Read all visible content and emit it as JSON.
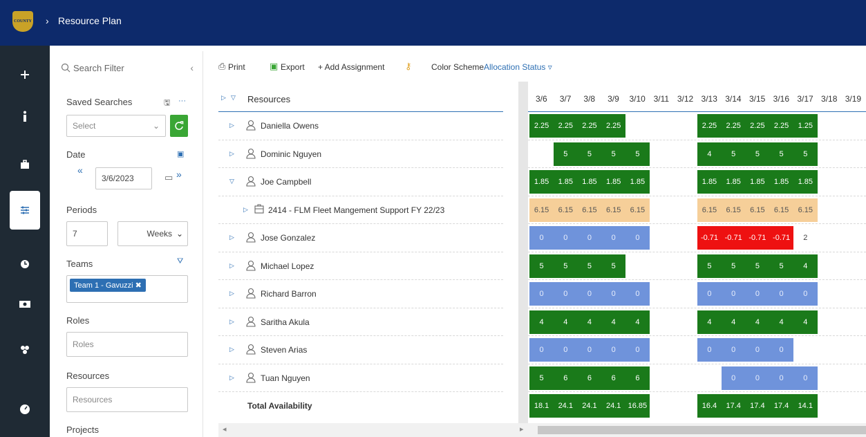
{
  "header": {
    "app_title": "Resource Plan",
    "logo_alt": "COUNTY"
  },
  "rail": {
    "items": [
      "plus-icon",
      "info-icon",
      "briefcase-icon",
      "sliders-icon",
      "clock-icon",
      "cash-icon",
      "people-icon",
      "dashboard-icon"
    ],
    "active_index": 3
  },
  "filter": {
    "search_placeholder": "Search Filter",
    "saved_searches_label": "Saved Searches",
    "saved_select_placeholder": "Select",
    "date_label": "Date",
    "date_value": "3/6/2023",
    "periods_label": "Periods",
    "periods_count": "7",
    "periods_unit": "Weeks",
    "teams_label": "Teams",
    "team_tag": "Team 1 - Gavuzzi",
    "roles_label": "Roles",
    "roles_placeholder": "Roles",
    "resources_label": "Resources",
    "resources_placeholder": "Resources",
    "projects_label": "Projects"
  },
  "toolbar": {
    "print": "Print",
    "export": "Export",
    "add_assignment": "+ Add Assignment",
    "color_scheme_label": "Color Scheme",
    "color_scheme_value": "Allocation Status"
  },
  "grid": {
    "resources_header": "Resources",
    "dates": [
      "3/6",
      "3/7",
      "3/8",
      "3/9",
      "3/10",
      "3/11",
      "3/12",
      "3/13",
      "3/14",
      "3/15",
      "3/16",
      "3/17",
      "3/18",
      "3/19"
    ],
    "rows": [
      {
        "name": "Daniella Owens",
        "type": "person",
        "expand": "collapsed"
      },
      {
        "name": "Dominic Nguyen",
        "type": "person",
        "expand": "collapsed"
      },
      {
        "name": "Joe Campbell",
        "type": "person",
        "expand": "expanded"
      },
      {
        "name": "2414 - FLM Fleet Mangement Support FY 22/23",
        "type": "project",
        "expand": "collapsed"
      },
      {
        "name": "Jose Gonzalez",
        "type": "person",
        "expand": "collapsed"
      },
      {
        "name": "Michael Lopez",
        "type": "person",
        "expand": "collapsed"
      },
      {
        "name": "Richard Barron",
        "type": "person",
        "expand": "collapsed"
      },
      {
        "name": "Saritha Akula",
        "type": "person",
        "expand": "collapsed"
      },
      {
        "name": "Steven Arias",
        "type": "person",
        "expand": "collapsed"
      },
      {
        "name": "Tuan Nguyen",
        "type": "person",
        "expand": "collapsed"
      }
    ],
    "total_label": "Total Availability",
    "cells": [
      [
        [
          "2.25",
          "g"
        ],
        [
          "2.25",
          "g"
        ],
        [
          "2.25",
          "g"
        ],
        [
          "2.25",
          "g"
        ],
        [
          "",
          ""
        ],
        [
          "",
          ""
        ],
        [
          "",
          ""
        ],
        [
          "2.25",
          "g"
        ],
        [
          "2.25",
          "g"
        ],
        [
          "2.25",
          "g"
        ],
        [
          "2.25",
          "g"
        ],
        [
          "1.25",
          "g"
        ]
      ],
      [
        [
          "",
          ""
        ],
        [
          "5",
          "g"
        ],
        [
          "5",
          "g"
        ],
        [
          "5",
          "g"
        ],
        [
          "5",
          "g"
        ],
        [
          "",
          ""
        ],
        [
          "",
          ""
        ],
        [
          "4",
          "g"
        ],
        [
          "5",
          "g"
        ],
        [
          "5",
          "g"
        ],
        [
          "5",
          "g"
        ],
        [
          "5",
          "g"
        ]
      ],
      [
        [
          "1.85",
          "g"
        ],
        [
          "1.85",
          "g"
        ],
        [
          "1.85",
          "g"
        ],
        [
          "1.85",
          "g"
        ],
        [
          "1.85",
          "g"
        ],
        [
          "",
          ""
        ],
        [
          "",
          ""
        ],
        [
          "1.85",
          "g"
        ],
        [
          "1.85",
          "g"
        ],
        [
          "1.85",
          "g"
        ],
        [
          "1.85",
          "g"
        ],
        [
          "1.85",
          "g"
        ]
      ],
      [
        [
          "6.15",
          "o"
        ],
        [
          "6.15",
          "o"
        ],
        [
          "6.15",
          "o"
        ],
        [
          "6.15",
          "o"
        ],
        [
          "6.15",
          "o"
        ],
        [
          "",
          ""
        ],
        [
          "",
          ""
        ],
        [
          "6.15",
          "o"
        ],
        [
          "6.15",
          "o"
        ],
        [
          "6.15",
          "o"
        ],
        [
          "6.15",
          "o"
        ],
        [
          "6.15",
          "o"
        ]
      ],
      [
        [
          "0",
          "b"
        ],
        [
          "0",
          "b"
        ],
        [
          "0",
          "b"
        ],
        [
          "0",
          "b"
        ],
        [
          "0",
          "b"
        ],
        [
          "",
          ""
        ],
        [
          "",
          ""
        ],
        [
          "-0.71",
          "r"
        ],
        [
          "-0.71",
          "r"
        ],
        [
          "-0.71",
          "r"
        ],
        [
          "-0.71",
          "r"
        ],
        [
          "2",
          "p"
        ]
      ],
      [
        [
          "5",
          "g"
        ],
        [
          "5",
          "g"
        ],
        [
          "5",
          "g"
        ],
        [
          "5",
          "g"
        ],
        [
          "",
          ""
        ],
        [
          "",
          ""
        ],
        [
          "",
          ""
        ],
        [
          "5",
          "g"
        ],
        [
          "5",
          "g"
        ],
        [
          "5",
          "g"
        ],
        [
          "5",
          "g"
        ],
        [
          "4",
          "g"
        ]
      ],
      [
        [
          "0",
          "b"
        ],
        [
          "0",
          "b"
        ],
        [
          "0",
          "b"
        ],
        [
          "0",
          "b"
        ],
        [
          "0",
          "b"
        ],
        [
          "",
          ""
        ],
        [
          "",
          ""
        ],
        [
          "0",
          "b"
        ],
        [
          "0",
          "b"
        ],
        [
          "0",
          "b"
        ],
        [
          "0",
          "b"
        ],
        [
          "0",
          "b"
        ]
      ],
      [
        [
          "4",
          "g"
        ],
        [
          "4",
          "g"
        ],
        [
          "4",
          "g"
        ],
        [
          "4",
          "g"
        ],
        [
          "4",
          "g"
        ],
        [
          "",
          ""
        ],
        [
          "",
          ""
        ],
        [
          "4",
          "g"
        ],
        [
          "4",
          "g"
        ],
        [
          "4",
          "g"
        ],
        [
          "4",
          "g"
        ],
        [
          "4",
          "g"
        ]
      ],
      [
        [
          "0",
          "b"
        ],
        [
          "0",
          "b"
        ],
        [
          "0",
          "b"
        ],
        [
          "0",
          "b"
        ],
        [
          "0",
          "b"
        ],
        [
          "",
          ""
        ],
        [
          "",
          ""
        ],
        [
          "0",
          "b"
        ],
        [
          "0",
          "b"
        ],
        [
          "0",
          "b"
        ],
        [
          "0",
          "b"
        ],
        [
          "",
          ""
        ]
      ],
      [
        [
          "5",
          "g"
        ],
        [
          "6",
          "g"
        ],
        [
          "6",
          "g"
        ],
        [
          "6",
          "g"
        ],
        [
          "6",
          "g"
        ],
        [
          "",
          ""
        ],
        [
          "",
          ""
        ],
        [
          "",
          ""
        ],
        [
          "0",
          "b"
        ],
        [
          "0",
          "b"
        ],
        [
          "0",
          "b"
        ],
        [
          "0",
          "b"
        ]
      ],
      [
        [
          "18.1",
          "g"
        ],
        [
          "24.1",
          "g"
        ],
        [
          "24.1",
          "g"
        ],
        [
          "24.1",
          "g"
        ],
        [
          "16.85",
          "g"
        ],
        [
          "",
          ""
        ],
        [
          "",
          ""
        ],
        [
          "16.4",
          "g"
        ],
        [
          "17.4",
          "g"
        ],
        [
          "17.4",
          "g"
        ],
        [
          "17.4",
          "g"
        ],
        [
          "14.1",
          "g"
        ]
      ]
    ]
  },
  "colors": {
    "header_bg": "#0d2a6b",
    "rail_bg": "#1f2a34",
    "green": "#1a7a1a",
    "blue": "#6f93db",
    "orange": "#f6cf99",
    "red": "#ee1111",
    "accent": "#2d6fb3"
  }
}
